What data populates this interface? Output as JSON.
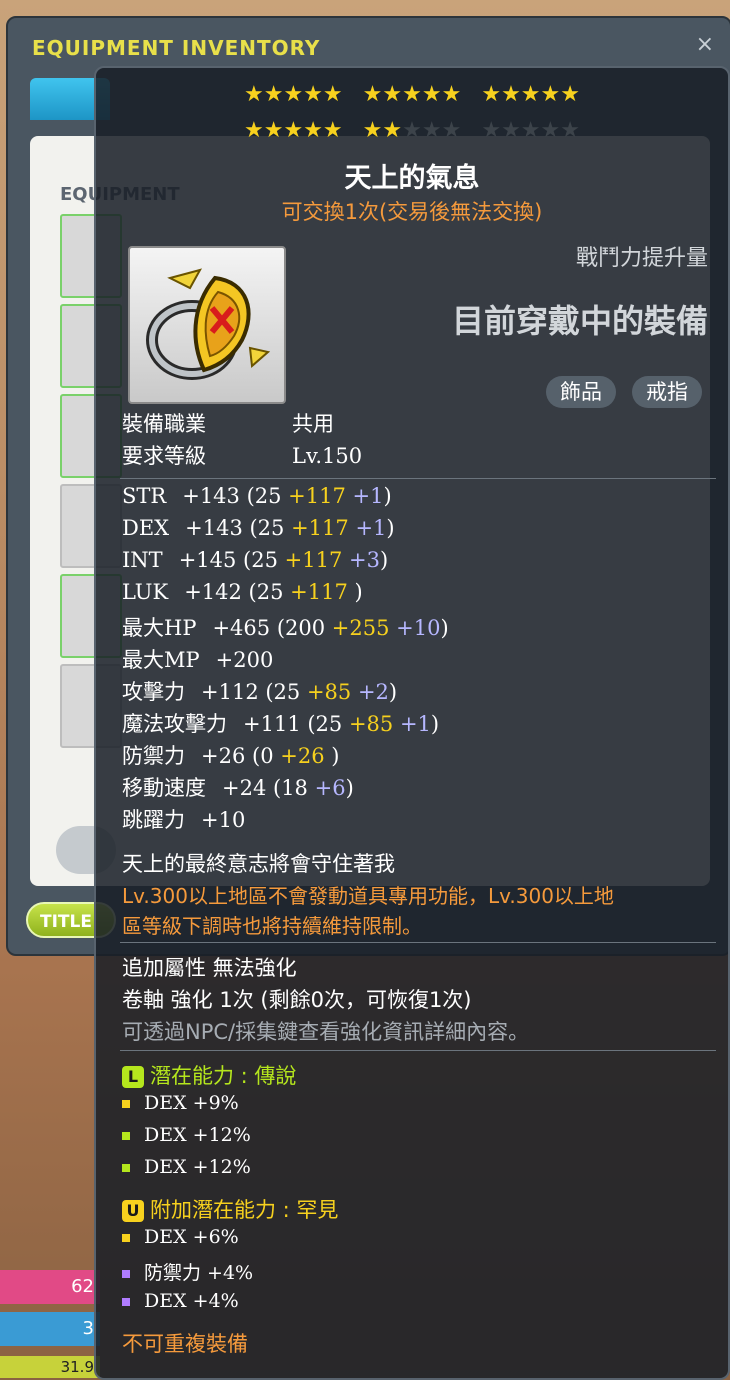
{
  "inventory": {
    "title": "EQUIPMENT INVENTORY",
    "close": "×",
    "panel_label": "EQUIPMENT",
    "title_button": "TITLE"
  },
  "player_bars": {
    "hp_text": "62",
    "mp_text": "3",
    "exp_text": "31.9"
  },
  "tooltip": {
    "stars_total": 30,
    "stars_filled": 22,
    "name": "天上的氣息",
    "trade_note": "可交換1次(交易後無法交換)",
    "compare_label": "戰鬥力提升量",
    "compare_main": "目前穿戴中的裝備",
    "tags": [
      "飾品",
      "戒指"
    ],
    "requirements": [
      {
        "label": "裝備職業",
        "value": "共用"
      },
      {
        "label": "要求等級",
        "value": "Lv.150"
      }
    ],
    "stats": [
      {
        "label": "STR",
        "total": "+143",
        "base": "(25",
        "bonus": "+117",
        "enhance": "+1",
        "close": ")"
      },
      {
        "label": "DEX",
        "total": "+143",
        "base": "(25",
        "bonus": "+117",
        "enhance": "+1",
        "close": ")"
      },
      {
        "label": "INT",
        "total": "+145",
        "base": "(25",
        "bonus": "+117",
        "enhance": "+3",
        "close": ")"
      },
      {
        "label": "LUK",
        "total": "+142",
        "base": "(25",
        "bonus": "+117",
        "enhance": "",
        "close": ")"
      },
      {
        "label": "最大HP",
        "total": "+465",
        "base": "(200",
        "bonus": "+255",
        "enhance": "+10",
        "close": ")"
      },
      {
        "label": "最大MP",
        "total": "+200",
        "base": "",
        "bonus": "",
        "enhance": "",
        "close": ""
      },
      {
        "label": "攻擊力",
        "total": "+112",
        "base": "(25",
        "bonus": "+85",
        "enhance": "+2",
        "close": ")"
      },
      {
        "label": "魔法攻擊力",
        "total": "+111",
        "base": "(25",
        "bonus": "+85",
        "enhance": "+1",
        "close": ")"
      },
      {
        "label": "防禦力",
        "total": "+26",
        "base": "(0",
        "bonus": "+26",
        "enhance": "",
        "close": ")"
      },
      {
        "label": "移動速度",
        "total": "+24",
        "base": "(18",
        "bonus": "",
        "enhance": "+6",
        "close": ")"
      },
      {
        "label": "跳躍力",
        "total": "+10",
        "base": "",
        "bonus": "",
        "enhance": "",
        "close": ""
      }
    ],
    "description": "天上的最終意志將會守住著我",
    "warning_line1": "Lv.300以上地區不會發動道具專用功能，Lv.300以上地",
    "warning_line2": "區等級下調時也將持續維持限制。",
    "extra_line1": "追加屬性 無法強化",
    "extra_line2": "卷軸 強化 1次 (剩餘0次，可恢復1次)",
    "extra_line3": "可透過NPC/採集鍵查看強化資訊詳細內容。",
    "potential": {
      "badge": "L",
      "title": "潛在能力 : 傳說",
      "color": "#b5e61d",
      "lines": [
        "DEX +9%",
        "DEX +12%",
        "DEX +12%"
      ],
      "bullet_colors": [
        "#f7d11e",
        "#b5e61d",
        "#b5e61d"
      ]
    },
    "additional_potential": {
      "badge": "U",
      "title": "附加潛在能力 : 罕見",
      "color": "#f7d11e",
      "lines": [
        "DEX +6%",
        "防禦力 +4%",
        "DEX +4%"
      ],
      "bullet_colors": [
        "#f7d11e",
        "#b07cff",
        "#b07cff"
      ]
    },
    "footer": "不可重複裝備"
  }
}
